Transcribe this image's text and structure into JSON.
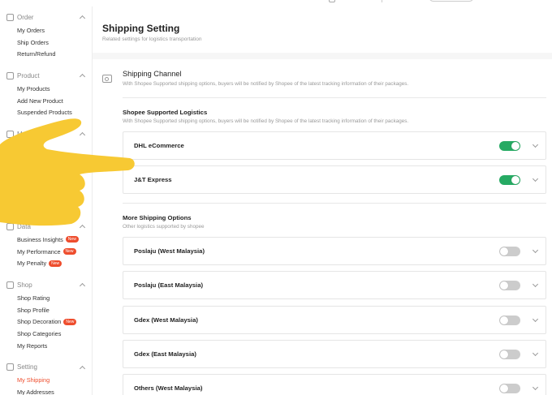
{
  "sidebar": {
    "sections": [
      {
        "title": "Order",
        "items": [
          {
            "label": "My Orders"
          },
          {
            "label": "Ship Orders"
          },
          {
            "label": "Return/Refund"
          }
        ]
      },
      {
        "title": "Product",
        "items": [
          {
            "label": "My Products"
          },
          {
            "label": "Add New Product"
          },
          {
            "label": "Suspended Products"
          }
        ]
      },
      {
        "title": "Marketing",
        "items": []
      },
      {
        "title": "Data",
        "items": [
          {
            "label": "Business Insights",
            "badge": "New"
          },
          {
            "label": "My Performance",
            "badge": "New"
          },
          {
            "label": "My Penalty",
            "badge": "New"
          }
        ]
      },
      {
        "title": "Shop",
        "items": [
          {
            "label": "Shop Rating"
          },
          {
            "label": "Shop Profile"
          },
          {
            "label": "Shop Decoration",
            "badge": "New"
          },
          {
            "label": "Shop Categories"
          },
          {
            "label": "My Reports"
          }
        ]
      },
      {
        "title": "Setting",
        "items": [
          {
            "label": "My Shipping",
            "active": true
          },
          {
            "label": "My Addresses"
          }
        ]
      }
    ]
  },
  "page": {
    "title": "Shipping Setting",
    "subtitle": "Related settings for logistics transportation"
  },
  "channel": {
    "title": "Shipping Channel",
    "description": "With Shopee Supported shipping options, buyers will be notified by Shopee of the latest tracking information of their packages."
  },
  "supported": {
    "title": "Shopee Supported Logistics",
    "description": "With Shopee Supported shipping options, buyers will be notified by Shopee of the latest tracking information of their packages.",
    "options": [
      {
        "name": "DHL eCommerce",
        "enabled": true
      },
      {
        "name": "J&T Express",
        "enabled": true
      }
    ]
  },
  "more": {
    "title": "More Shipping Options",
    "description": "Other logistics supported by shopee",
    "options": [
      {
        "name": "Poslaju (West Malaysia)",
        "enabled": false
      },
      {
        "name": "Poslaju (East Malaysia)",
        "enabled": false
      },
      {
        "name": "Gdex (West Malaysia)",
        "enabled": false
      },
      {
        "name": "Gdex (East Malaysia)",
        "enabled": false
      },
      {
        "name": "Others (West Malaysia)",
        "enabled": false
      }
    ]
  },
  "colors": {
    "accent": "#ee4d2d",
    "toggle_on": "#26aa63",
    "toggle_off": "#cccccc",
    "overlay": "#f7c933"
  }
}
